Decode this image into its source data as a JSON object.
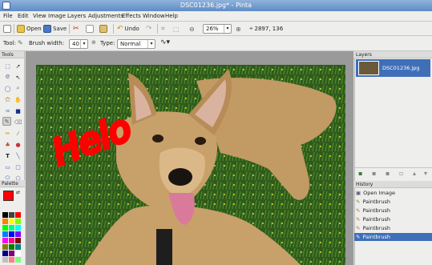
{
  "window": {
    "title": "DSC01236.jpg* - Pinta"
  },
  "menu": [
    "File",
    "Edit",
    "View",
    "Image",
    "Layers",
    "Adjustments",
    "Effects",
    "Window",
    "Help"
  ],
  "toolbar": {
    "open_label": "Open",
    "save_label": "Save",
    "undo_label": "Undo",
    "zoom_value": "26%",
    "cursor_pos": "2897, 136"
  },
  "tool_options": {
    "tool_label": "Tool:",
    "brush_width_label": "Brush width:",
    "brush_width_value": "40",
    "type_label": "Type:",
    "type_value": "Normal"
  },
  "panels": {
    "tools_header": "Tools",
    "palette_header": "Palette",
    "layers_header": "Layers",
    "history_header": "History"
  },
  "layers": [
    {
      "name": "DSC01236.jpg"
    }
  ],
  "history": [
    {
      "label": "Open Image"
    },
    {
      "label": "Paintbrush"
    },
    {
      "label": "Paintbrush"
    },
    {
      "label": "Paintbrush"
    },
    {
      "label": "Paintbrush"
    },
    {
      "label": "Paintbrush"
    }
  ],
  "canvas": {
    "painted_text": "Helo"
  },
  "colors": {
    "primary": "#ff0000",
    "secondary": "#ffffff",
    "selection": "#3f6fb8"
  }
}
